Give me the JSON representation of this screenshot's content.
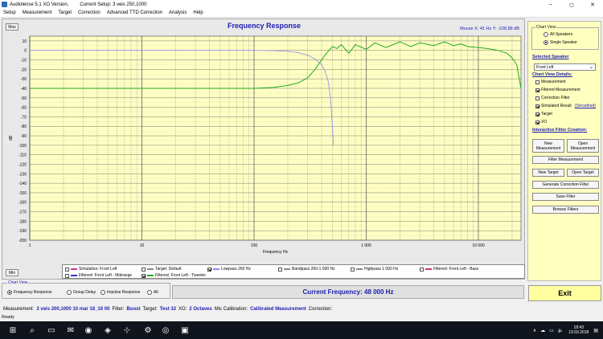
{
  "window": {
    "app_title": "Audiolense 5.1 XO Version.",
    "setup_title": "Current Setup: 3 veis 250,1000",
    "controls": [
      "–",
      "◻",
      "✕"
    ]
  },
  "menu": [
    "Setup",
    "Measurement",
    "Target",
    "Correction",
    "Advanced TTD Correction",
    "Analysis",
    "Help"
  ],
  "plot": {
    "max_label": "Max",
    "min_label": "Min",
    "mouse_readout": "Mouse X: 41 Hz   Y: -228,88 dB",
    "legend": [
      {
        "label": "Simulation: Front Left",
        "checked": false,
        "color": "#cc3399"
      },
      {
        "label": "Target: Default",
        "checked": false,
        "color": "#888888"
      },
      {
        "label": "Lowpass  260 Hz",
        "checked": true,
        "color": "#8888ff"
      },
      {
        "label": "Bandpass  260-1 000 Hz",
        "checked": false,
        "color": "#888888"
      },
      {
        "label": "Highpass  1 000 Hz",
        "checked": false,
        "color": "#888888"
      },
      {
        "label": "Filtered: Front Left - Bass",
        "checked": false,
        "color": "#cc3366"
      },
      {
        "label": "Filtered: Front Left - Midrange",
        "checked": false,
        "color": "#3333cc"
      },
      {
        "label": "Filtered: Front Left - Tweeter",
        "checked": true,
        "color": "#22aa22"
      }
    ]
  },
  "chart_data": {
    "type": "line",
    "title": "Frequency Response",
    "xlabel": "Frequency Hz",
    "ylabel": "dB",
    "xscale": "log",
    "xlim": [
      1,
      24000
    ],
    "ylim": [
      -200,
      15
    ],
    "x_ticks": [
      {
        "value": 1,
        "label": "1"
      },
      {
        "value": 10,
        "label": "10"
      },
      {
        "value": 100,
        "label": "100"
      },
      {
        "value": 1000,
        "label": "1 000"
      },
      {
        "value": 10000,
        "label": "10 000"
      }
    ],
    "y_ticks": [
      10,
      0,
      -10,
      -20,
      -30,
      -40,
      -50,
      -60,
      -70,
      -80,
      -90,
      -100,
      -110,
      -120,
      -130,
      -140,
      -150,
      -160,
      -170,
      -180,
      -190,
      -200
    ],
    "grid": true,
    "series": [
      {
        "name": "Lowpass  260 Hz",
        "color": "#8a8af0",
        "x": [
          1,
          50,
          100,
          150,
          200,
          250,
          300,
          350,
          400,
          430,
          460,
          480,
          500,
          510
        ],
        "y": [
          0,
          0,
          0,
          -0.3,
          -1,
          -2.5,
          -5,
          -9,
          -15,
          -22,
          -33,
          -50,
          -80,
          -100
        ]
      },
      {
        "name": "Filtered: Front Left - Tweeter",
        "color": "#22aa22",
        "x": [
          1,
          50,
          100,
          150,
          200,
          250,
          300,
          350,
          400,
          450,
          500,
          550,
          600,
          700,
          800,
          1000,
          1200,
          1500,
          2000,
          2500,
          3000,
          4000,
          5000,
          6000,
          7000,
          8000,
          10000,
          12000,
          15000,
          18000,
          20000,
          22000,
          24000
        ],
        "y": [
          -40,
          -40,
          -40,
          -39,
          -37,
          -34,
          -29,
          -20,
          -10,
          -2,
          4,
          2,
          6,
          -3,
          6,
          1,
          8,
          3,
          9,
          4,
          8,
          5,
          9,
          5,
          7,
          4,
          3,
          2,
          0,
          -3,
          -8,
          -15,
          -40
        ]
      }
    ]
  },
  "side": {
    "chart_view_label": "Chart View",
    "all_speakers": "All Speakers",
    "single_speaker": "Single Speaker",
    "selected_speaker_head": "Selected Speaker",
    "selected_speaker_value": "Front Left",
    "details_head": "Chart View Details:",
    "details": [
      {
        "label": "Measurement",
        "checked": false
      },
      {
        "label": "Filtered Measurement",
        "checked": true
      },
      {
        "label": "Correction Filter",
        "checked": false
      },
      {
        "label": "Simulated Result",
        "checked": true
      },
      {
        "label": "Target",
        "checked": true
      },
      {
        "label": "XO",
        "checked": true
      }
    ],
    "smoothed_link": "(Smoothed)",
    "filter_head": "Interactive Filter Creation:",
    "new_measurement": "New Measurement",
    "open_measurement": "Open Measurement",
    "filter_measurement": "Filter Measurement",
    "new_target": "New Target",
    "open_target": "Open Target",
    "generate_correction": "Generate Correction Filter",
    "save_filter": "Save Filter",
    "browse_filters": "Browse Filters"
  },
  "bottom": {
    "chart_view_label": "Chart View",
    "options": [
      {
        "label": "Frequency Response",
        "selected": true
      },
      {
        "label": "Group Delay",
        "selected": false
      },
      {
        "label": "Impulse Response",
        "selected": false
      },
      {
        "label": "All",
        "selected": false
      }
    ],
    "current_frequency": "Current Frequency: 48 000 Hz",
    "exit": "Exit"
  },
  "status": {
    "measurement_label": "Measurement:",
    "measurement_value": "3 veis 200,1000 10 mar 18_16 00",
    "filter_label": "Filter:",
    "filter_value": "Boost",
    "target_label": "Target:",
    "target_value": "Test 32",
    "xo_label": "XO:",
    "xo_value": "2 Octaves",
    "mic_label": "Mic Calibration:",
    "mic_value": "Calibrated Measurement",
    "correction_label": "Correction:",
    "ready": "Ready"
  },
  "taskbar": {
    "time": "18:43",
    "date": "10.03.2018"
  }
}
